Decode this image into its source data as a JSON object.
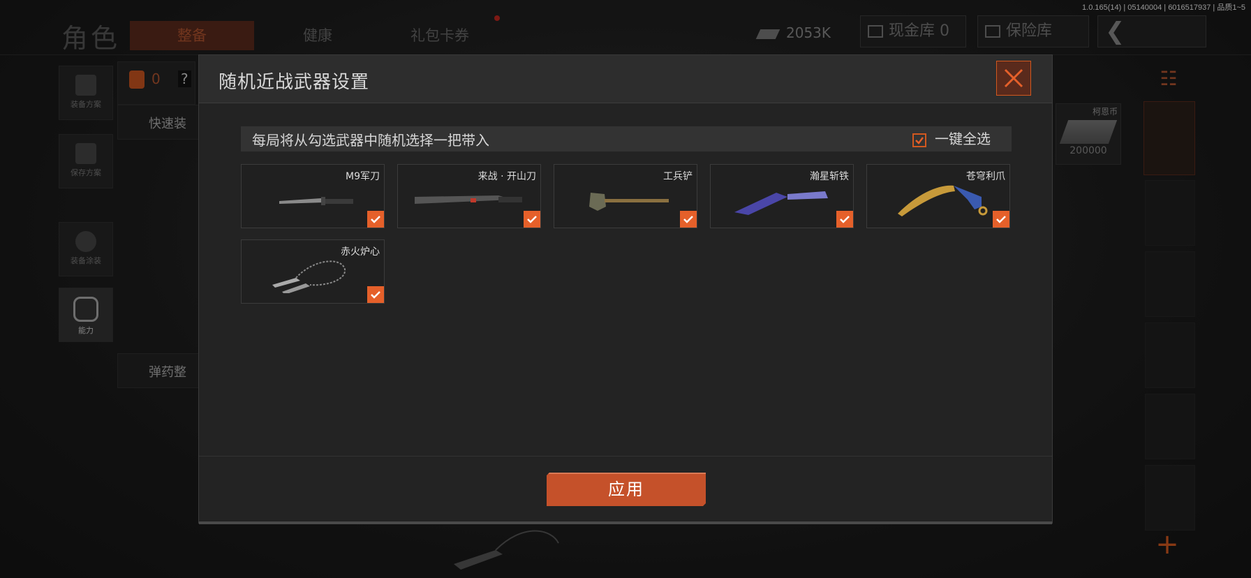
{
  "version": "1.0.165(14) | 05140004 | 6016517937 | 品质1~5",
  "header": {
    "title": "角色",
    "tabs": [
      {
        "label": "整备",
        "active": true
      },
      {
        "label": "健康",
        "active": false
      },
      {
        "label": "礼包卡券",
        "active": false
      }
    ],
    "currency_amount": "2053K",
    "cash_vault": "现金库 0",
    "insurance_vault": "保险库"
  },
  "left_menu": {
    "loadout": "装备方案",
    "save": "保存方案",
    "skin": "装备涂装",
    "ability": "能力",
    "backpack_count": "0",
    "question": "?",
    "quick_equip": "快速装",
    "ammo": "弹药整"
  },
  "right_panel": {
    "coin_label": "柯恩币",
    "coin_amount": "200000"
  },
  "modal": {
    "title": "随机近战武器设置",
    "subtitle": "每局将从勾选武器中随机选择一把带入",
    "select_all": "一键全选",
    "select_all_checked": true,
    "apply": "应用",
    "weapons": [
      {
        "name": "M9军刀",
        "checked": true,
        "icon": "bayonet-icon"
      },
      {
        "name": "来战 · 开山刀",
        "checked": true,
        "icon": "machete-icon"
      },
      {
        "name": "工兵铲",
        "checked": true,
        "icon": "shovel-icon"
      },
      {
        "name": "瀚星斩铁",
        "checked": true,
        "icon": "tanto-knife-icon"
      },
      {
        "name": "苍穹利爪",
        "checked": true,
        "icon": "karambit-icon"
      },
      {
        "name": "赤火炉心",
        "checked": true,
        "icon": "chain-daggers-icon"
      }
    ]
  },
  "colors": {
    "accent": "#e5602a",
    "apply_button": "#c5512a",
    "modal_bg": "#232323"
  }
}
